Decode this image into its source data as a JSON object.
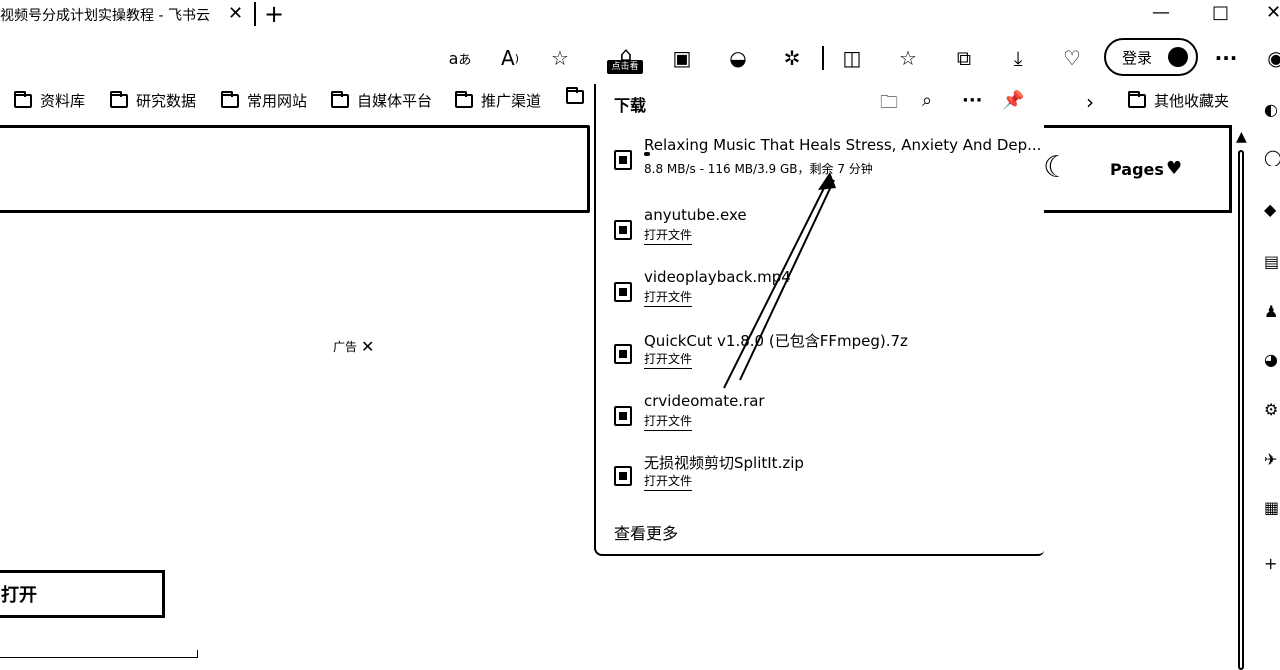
{
  "tab": {
    "title": "视频号分成计划实操教程 - 飞书云",
    "close": "✕",
    "new_tab": "+"
  },
  "window": {
    "minimize": "—",
    "maximize": "□",
    "close": "✕"
  },
  "toolbar": {
    "icons": [
      "translate-icon",
      "read-aloud-icon",
      "favorite-star-icon",
      "extension-badge-icon",
      "collections-icon",
      "copilot-icon",
      "puzzle-icon",
      "split-screen-icon",
      "favorites-icon",
      "tab-actions-icon",
      "downloads-icon",
      "health-icon"
    ],
    "extension_badge": "点击看",
    "login_label": "登录",
    "more": "···"
  },
  "bookmarks": {
    "items": [
      "资料库",
      "研究数据",
      "常用网站",
      "自媒体平台",
      "推广渠道"
    ],
    "other_folder": "其他收藏夹",
    "chevron": "›"
  },
  "page": {
    "ad_label": "广告",
    "ad_close": "✕",
    "open_button": "打开",
    "pages_label": "Pages",
    "heart": "♥",
    "moon": "☾"
  },
  "downloads": {
    "title": "下载",
    "see_more": "查看更多",
    "items": [
      {
        "name": "Relaxing Music That Heals Stress, Anxiety And Dep...",
        "status": "8.8 MB/s - 116 MB/3.9 GB，剩余 7 分钟",
        "in_progress": true,
        "progress": 0.03
      },
      {
        "name": "anyutube.exe",
        "action": "打开文件"
      },
      {
        "name": "videoplayback.mp4",
        "action": "打开文件"
      },
      {
        "name": "QuickCut v1.8.0 (已包含FFmpeg).7z",
        "action": "打开文件"
      },
      {
        "name": "crvideomate.rar",
        "action": "打开文件"
      },
      {
        "name": "无损视频剪切SplitIt.zip",
        "action": "打开文件"
      }
    ]
  }
}
